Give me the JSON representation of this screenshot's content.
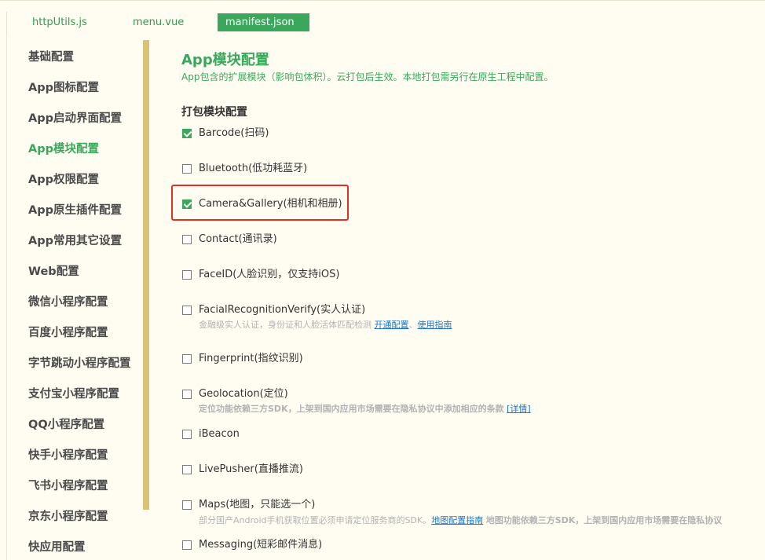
{
  "tabs": [
    {
      "label": "httpUtils.js",
      "active": false
    },
    {
      "label": "menu.vue",
      "active": false
    },
    {
      "label": "manifest.json",
      "active": true
    }
  ],
  "sidebar": {
    "items": [
      {
        "label": "基础配置"
      },
      {
        "label": "App图标配置"
      },
      {
        "label": "App启动界面配置"
      },
      {
        "label": "App模块配置",
        "active": true
      },
      {
        "label": "App权限配置"
      },
      {
        "label": "App原生插件配置"
      },
      {
        "label": "App常用其它设置"
      },
      {
        "label": "Web配置"
      },
      {
        "label": "微信小程序配置"
      },
      {
        "label": "百度小程序配置"
      },
      {
        "label": "字节跳动小程序配置"
      },
      {
        "label": "支付宝小程序配置"
      },
      {
        "label": "QQ小程序配置"
      },
      {
        "label": "快手小程序配置"
      },
      {
        "label": "飞书小程序配置"
      },
      {
        "label": "京东小程序配置"
      },
      {
        "label": "快应用配置"
      }
    ]
  },
  "main": {
    "title": "App模块配置",
    "subtitle": "App包含的扩展模块（影响包体积）。云打包后生效。本地打包需另行在原生工程中配置。",
    "section": "打包模块配置",
    "modules": [
      {
        "label": "Barcode(扫码)",
        "checked": true
      },
      {
        "label": "Bluetooth(低功耗蓝牙)",
        "checked": false
      },
      {
        "label": "Camera&Gallery(相机和相册)",
        "checked": true
      },
      {
        "label": "Contact(通讯录)",
        "checked": false
      },
      {
        "label": "FaceID(人脸识别，仅支持iOS)",
        "checked": false
      },
      {
        "label": "FacialRecognitionVerify(实人认证)",
        "checked": false
      },
      {
        "label": "Fingerprint(指纹识别)",
        "checked": false
      },
      {
        "label": "Geolocation(定位)",
        "checked": false
      },
      {
        "label": "iBeacon",
        "checked": false
      },
      {
        "label": "LivePusher(直播推流)",
        "checked": false
      },
      {
        "label": "Maps(地图，只能选一个)",
        "checked": false
      },
      {
        "label": "Messaging(短彩邮件消息)",
        "checked": false
      }
    ],
    "facial_desc": {
      "text": "金融级实人认证，身份证和人脸活体匹配检测",
      "link1": "开通配置",
      "sep": "、",
      "link2": "使用指南"
    },
    "geo_desc": {
      "text": "定位功能依赖三方SDK，上架到国内应用市场需要在隐私协议中添加相应的条款",
      "link": "[详情]"
    },
    "maps_desc": {
      "text": "部分国产Android手机获取位置必须申请定位服务商的SDK。",
      "link": "地图配置指南",
      "text2": "地图功能依赖三方SDK，上架到国内应用市场需要在隐私协议"
    }
  },
  "colors": {
    "accent": "#3aa75c",
    "highlight": "#e03124",
    "thumb": "#d8c377",
    "bg": "#fffdf2"
  }
}
